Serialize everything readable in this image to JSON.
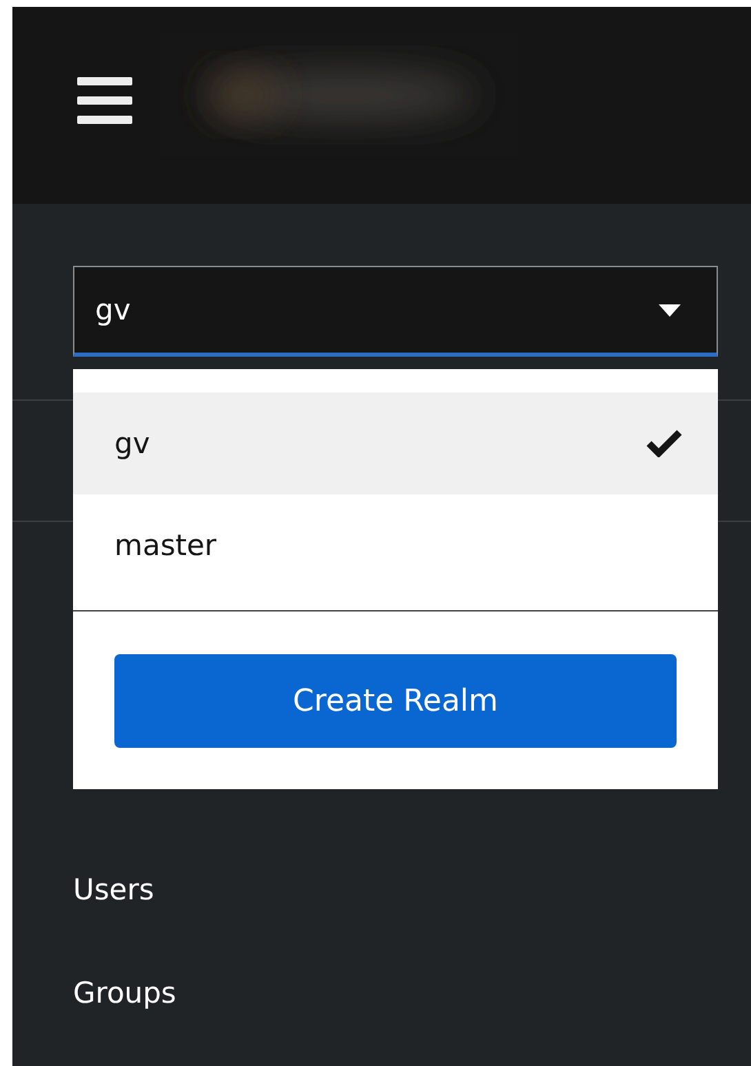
{
  "realm_select": {
    "value": "gv",
    "expanded": true
  },
  "realm_menu": {
    "items": [
      {
        "label": "gv",
        "selected": true
      },
      {
        "label": "master",
        "selected": false
      }
    ],
    "button": "Create Realm"
  },
  "nav": {
    "items": [
      {
        "label": "Users"
      },
      {
        "label": "Groups"
      }
    ]
  }
}
